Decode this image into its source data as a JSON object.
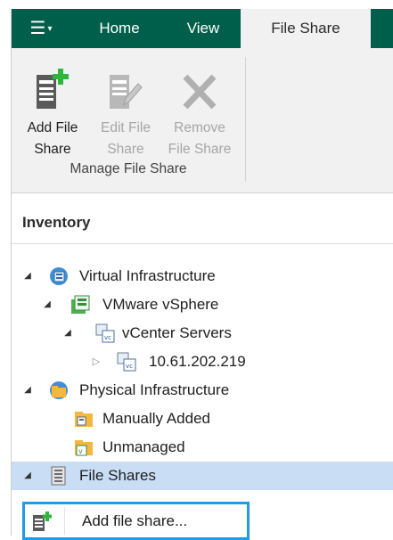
{
  "ribbon": {
    "tabs": [
      {
        "label": "Home"
      },
      {
        "label": "View"
      },
      {
        "label": "File Share",
        "active": true
      }
    ],
    "menu_icon": "hamburger-menu-icon",
    "buttons": [
      {
        "line1": "Add File",
        "line2": "Share",
        "enabled": true,
        "icon": "add-file-share-icon"
      },
      {
        "line1": "Edit File",
        "line2": "Share",
        "enabled": false,
        "icon": "edit-file-share-icon"
      },
      {
        "line1": "Remove",
        "line2": "File Share",
        "enabled": false,
        "icon": "remove-x-icon"
      }
    ],
    "group_label": "Manage File Share"
  },
  "inventory": {
    "title": "Inventory",
    "tree": [
      {
        "label": "Virtual Infrastructure",
        "icon": "virtual-infrastructure-icon",
        "expanded": true
      },
      {
        "label": "VMware vSphere",
        "icon": "vmware-vsphere-icon",
        "expanded": true
      },
      {
        "label": "vCenter Servers",
        "icon": "vcenter-servers-icon",
        "expanded": true
      },
      {
        "label": "10.61.202.219",
        "icon": "vcenter-server-icon",
        "expanded": false
      },
      {
        "label": "Physical Infrastructure",
        "icon": "physical-infrastructure-icon",
        "expanded": true
      },
      {
        "label": "Manually Added",
        "icon": "manually-added-icon"
      },
      {
        "label": "Unmanaged",
        "icon": "unmanaged-icon"
      },
      {
        "label": "File Shares",
        "icon": "file-shares-icon",
        "expanded": true,
        "selected": true
      }
    ]
  },
  "context_menu": {
    "items": [
      {
        "label": "Add file share...",
        "icon": "add-file-share-icon"
      }
    ]
  },
  "colors": {
    "ribbon_tab_bar": "#005f4b",
    "ribbon_body": "#f1f1f1",
    "selection": "#c9def5",
    "highlight_border": "#1e9be6",
    "add_accent": "#2fb53a"
  }
}
